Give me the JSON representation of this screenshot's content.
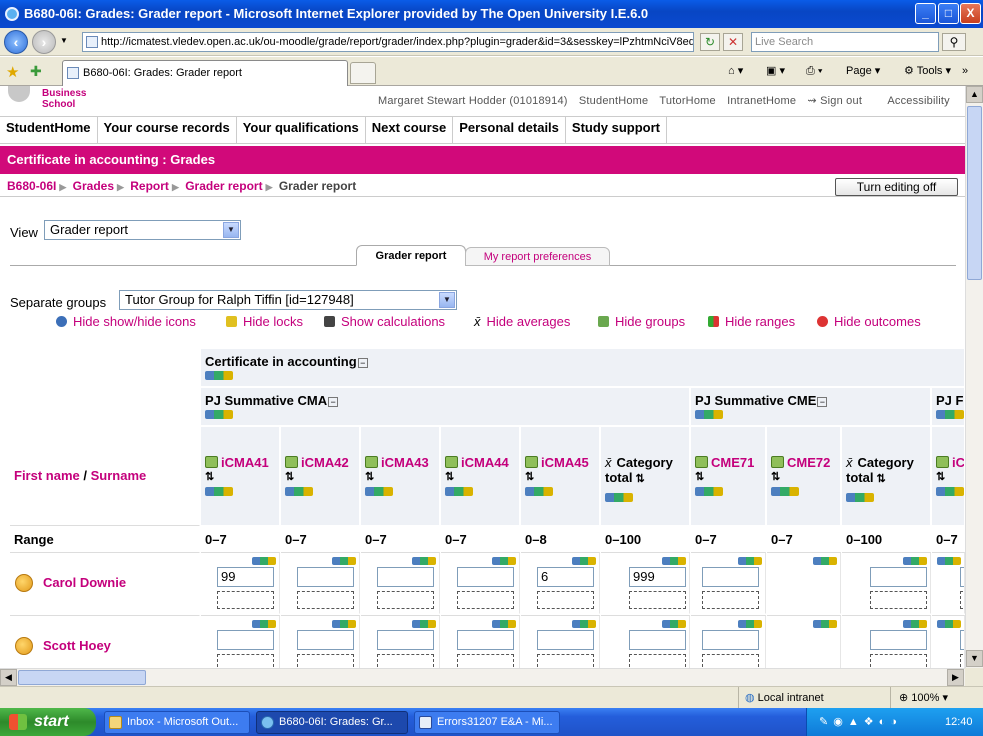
{
  "window": {
    "title": "B680-06I: Grades: Grader report - Microsoft Internet Explorer provided by The Open University I.E.6.0",
    "minimize": "_",
    "maximize": "□",
    "close": "X"
  },
  "addressbar": {
    "url": "http://icmatest.vledev.open.ac.uk/ou-moodle/grade/report/grader/index.php?plugin=grader&id=3&sesskey=lPzhtmNciV8ed",
    "search_placeholder": "Live Search"
  },
  "tabs": {
    "active_tab": "B680-06I: Grades: Grader report",
    "commands": {
      "page": "Page",
      "tools": "Tools"
    }
  },
  "site": {
    "logo_text": "Business School",
    "user_name": "Margaret Stewart Hodder (01018914)",
    "user_links": [
      "StudentHome",
      "TutorHome",
      "IntranetHome",
      "Sign out",
      "Accessibility"
    ],
    "main_nav": [
      "StudentHome",
      "Your course records",
      "Your qualifications",
      "Next course",
      "Personal details",
      "Study support"
    ],
    "page_heading": "Certificate in accounting : Grades",
    "breadcrumb": [
      "B680-06I",
      "Grades",
      "Report",
      "Grader report",
      "Grader report"
    ],
    "edit_button": "Turn editing off"
  },
  "report": {
    "view_label": "View",
    "view_value": "Grader report",
    "tab_active": "Grader report",
    "tab_prefs": "My report preferences",
    "groups_label": "Separate groups",
    "groups_value": "Tutor Group for Ralph Tiffin [id=127948]",
    "toggles": [
      "Hide show/hide icons",
      "Hide locks",
      "Show calculations",
      "Hide averages",
      "Hide groups",
      "Hide ranges",
      "Hide outcomes"
    ],
    "course_category": "Certificate in accounting",
    "subcategories": [
      "PJ Summative CMA",
      "PJ Summative CME",
      "PJ F"
    ],
    "name_header_first": "First name",
    "name_header_slash": "/",
    "name_header_last": "Surname",
    "items": [
      "iCMA41",
      "iCMA42",
      "iCMA43",
      "iCMA44",
      "iCMA45",
      "Category total",
      "CME71",
      "CME72",
      "Category total",
      "iC (for"
    ],
    "range_label": "Range",
    "ranges": [
      "0–7",
      "0–7",
      "0–7",
      "0–7",
      "0–8",
      "0–100",
      "0–7",
      "0–7",
      "0–100",
      "0–7"
    ],
    "students": [
      {
        "name": "Carol Downie",
        "grades": [
          "99",
          "",
          "",
          "",
          "6",
          "999",
          "",
          "",
          "",
          ""
        ]
      },
      {
        "name": "Scott Hoey",
        "grades": [
          "",
          "",
          "",
          "",
          "",
          "",
          "",
          "",
          "",
          ""
        ]
      }
    ]
  },
  "status": {
    "zone": "Local intranet",
    "zoom": "100%"
  },
  "taskbar": {
    "start": "start",
    "items": [
      "Inbox - Microsoft Out...",
      "B680-06I: Grades: Gr...",
      "Errors31207 E&A - Mi..."
    ],
    "clock": "12:40"
  }
}
